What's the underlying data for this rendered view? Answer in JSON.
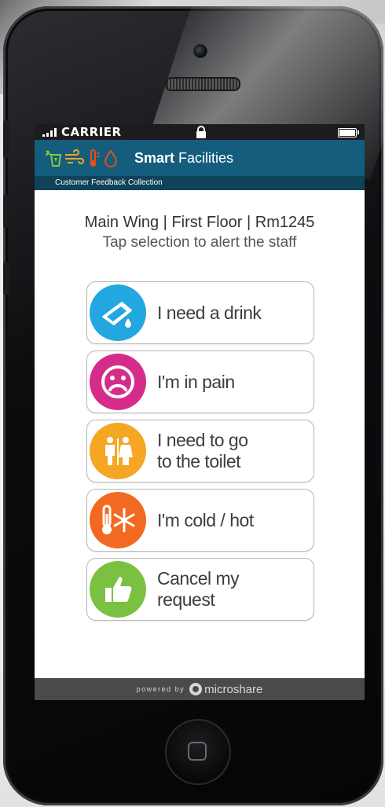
{
  "status_bar": {
    "carrier": "CARRIER"
  },
  "app_header": {
    "title_bold": "Smart",
    "title_regular": " Facilities",
    "subtitle": "Customer Feedback Collection"
  },
  "location": {
    "text": "Main Wing  |  First Floor  |  Rm1245",
    "hint": "Tap selection to alert the staff"
  },
  "options": [
    {
      "label": "I need a drink",
      "icon": "drink-glass-icon",
      "color": "#22a7e0"
    },
    {
      "label": "I'm in pain",
      "icon": "sad-face-icon",
      "color": "#d52c8a"
    },
    {
      "label": "I need to go\nto the toilet",
      "icon": "toilet-icon",
      "color": "#f5a623"
    },
    {
      "label": "I'm cold / hot",
      "icon": "thermometer-snowflake-icon",
      "color": "#f26a21"
    },
    {
      "label": "Cancel my\nrequest",
      "icon": "thumbs-up-icon",
      "color": "#7ac142"
    }
  ],
  "footer": {
    "powered_by": "powered by",
    "brand": "microshare"
  },
  "colors": {
    "header": "#155d7d",
    "subheader": "#0f4359",
    "footer": "#4a4a4a"
  }
}
